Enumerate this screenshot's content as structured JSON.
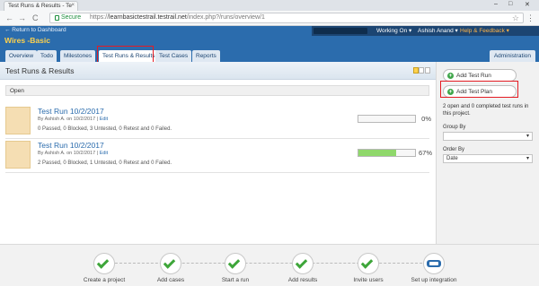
{
  "browser": {
    "tab_title": "Test Runs & Results - Te",
    "tab_close": "×",
    "secure_label": "Secure",
    "url_prefix": "https://",
    "url_host": "learnbasictestrail.testrail.net",
    "url_path": "/index.php?/runs/overview/1",
    "star": "☆",
    "menu": "⋮",
    "back": "←",
    "forward": "→",
    "reload": "C",
    "min": "–",
    "max": "□",
    "close": "✕"
  },
  "header": {
    "return_link": "← Return to Dashboard",
    "project_title": "Wires -Basic",
    "working_on": "Working On ▾",
    "user": "Ashish Anand ▾",
    "help": "Help & Feedback ▾",
    "tabs": [
      "Overview",
      "Todo",
      "Milestones",
      "Test Runs & Results",
      "Test Cases",
      "Reports"
    ],
    "active_tab": "Test Runs & Results",
    "admin_tab": "Administration"
  },
  "main": {
    "page_title": "Test Runs & Results",
    "section_open": "Open",
    "runs": [
      {
        "title": "Test Run 10/2/2017",
        "by_prefix": "By Ashish A. on 10/2/2017 |",
        "edit": "Edit",
        "stats": "0 Passed, 0 Blocked, 3 Untested, 0 Retest and 0 Failed.",
        "percent_label": "0%",
        "progress": 0
      },
      {
        "title": "Test Run 10/2/2017",
        "by_prefix": "By Ashish A. on 10/2/2017 |",
        "edit": "Edit",
        "stats": "2 Passed, 0 Blocked, 1 Untested, 0 Retest and 0 Failed.",
        "percent_label": "67%",
        "progress": 0.67
      }
    ]
  },
  "sidebar": {
    "add_run": "Add Test Run",
    "add_plan": "Add Test Plan",
    "info": "2 open and 0 completed test runs in this project.",
    "group_by_label": "Group By",
    "group_by_value": "",
    "order_by_label": "Order By",
    "order_by_value": "Date",
    "caret": "▾"
  },
  "footer": {
    "steps": [
      "Create a project",
      "Add cases",
      "Start a run",
      "Add results",
      "Invite users",
      "Set up integration"
    ]
  },
  "colors": {
    "header_blue": "#2b6cad",
    "title_yellow": "#ffd24d",
    "progress_green": "#8fd86b",
    "highlight_red": "#e41b23"
  }
}
